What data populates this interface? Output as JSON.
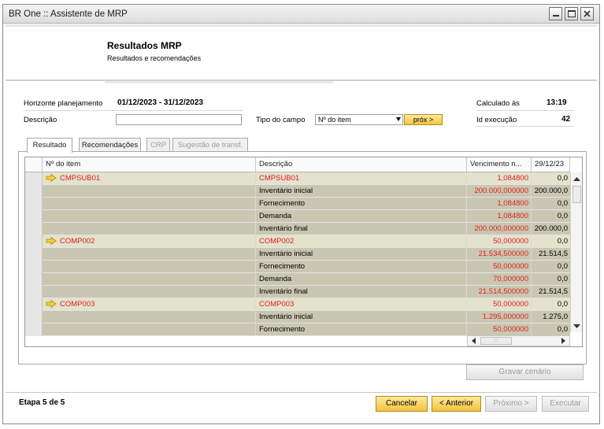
{
  "window": {
    "title": "BR One :: Assistente de MRP"
  },
  "header": {
    "title": "Resultados MRP",
    "subtitle": "Resultados e recomendações"
  },
  "form": {
    "horizonte_label": "Horizonte planejamento",
    "horizonte_value": "01/12/2023 - 31/12/2023",
    "descricao_label": "Descrição",
    "descricao_value": "",
    "tipo_campo_label": "Tipo do campo",
    "tipo_campo_value": "Nº do item",
    "prox_label": "próx >",
    "calculado_label": "Calculado às",
    "calculado_value": "13:19",
    "id_execucao_label": "Id execução",
    "id_execucao_value": "42"
  },
  "tabs": [
    {
      "label": "Resultado"
    },
    {
      "label": "Recomendações"
    },
    {
      "label": "CRP"
    },
    {
      "label": "Sugestão de transf."
    }
  ],
  "grid": {
    "columns": [
      "Nº do item",
      "Descrição",
      "Vencimento n...",
      "29/12/23"
    ],
    "rows": [
      {
        "item": "CMPSUB01",
        "desc": "CMPSUB01",
        "v1": "1,084800",
        "v2": "0,0",
        "kind": "parent"
      },
      {
        "item": "",
        "desc": "Inventário inicial",
        "v1": "200.000,000000",
        "v2": "200.000,0",
        "kind": "child"
      },
      {
        "item": "",
        "desc": "Fornecimento",
        "v1": "1,084800",
        "v2": "0,0",
        "kind": "child"
      },
      {
        "item": "",
        "desc": "Demanda",
        "v1": "1,084800",
        "v2": "0,0",
        "kind": "child"
      },
      {
        "item": "",
        "desc": "Inventário final",
        "v1": "200.000,000000",
        "v2": "200.000,0",
        "kind": "child"
      },
      {
        "item": "COMP002",
        "desc": "COMP002",
        "v1": "50,000000",
        "v2": "0,0",
        "kind": "parent"
      },
      {
        "item": "",
        "desc": "Inventário inicial",
        "v1": "21.534,500000",
        "v2": "21.514,5",
        "kind": "child"
      },
      {
        "item": "",
        "desc": "Fornecimento",
        "v1": "50,000000",
        "v2": "0,0",
        "kind": "child"
      },
      {
        "item": "",
        "desc": "Demanda",
        "v1": "70,000000",
        "v2": "0,0",
        "kind": "child"
      },
      {
        "item": "",
        "desc": "Inventário final",
        "v1": "21.514,500000",
        "v2": "21.514,5",
        "kind": "child"
      },
      {
        "item": "COMP003",
        "desc": "COMP003",
        "v1": "50,000000",
        "v2": "0,0",
        "kind": "parent"
      },
      {
        "item": "",
        "desc": "Inventário inicial",
        "v1": "1.295,000000",
        "v2": "1.275,0",
        "kind": "child"
      },
      {
        "item": "",
        "desc": "Fornecimento",
        "v1": "50,000000",
        "v2": "0,0",
        "kind": "child"
      }
    ],
    "scroll_grip": ":::"
  },
  "buttons": {
    "gravar_cenario": "Gravar cenário",
    "cancelar": "Cancelar",
    "anterior": "< Anterior",
    "proximo": "Próximo >",
    "executar": "Executar"
  },
  "footer": {
    "etapa": "Etapa 5 de 5"
  },
  "colors": {
    "parent_row": "#e3e2cd",
    "child_row": "#c9c7b2",
    "value_red": "#e02020",
    "accent_gold": "#f4c23b"
  },
  "icons": {
    "minimize": "minimize-icon",
    "maximize": "maximize-icon",
    "close": "close-icon",
    "row_arrow": "arrow-right-icon"
  }
}
